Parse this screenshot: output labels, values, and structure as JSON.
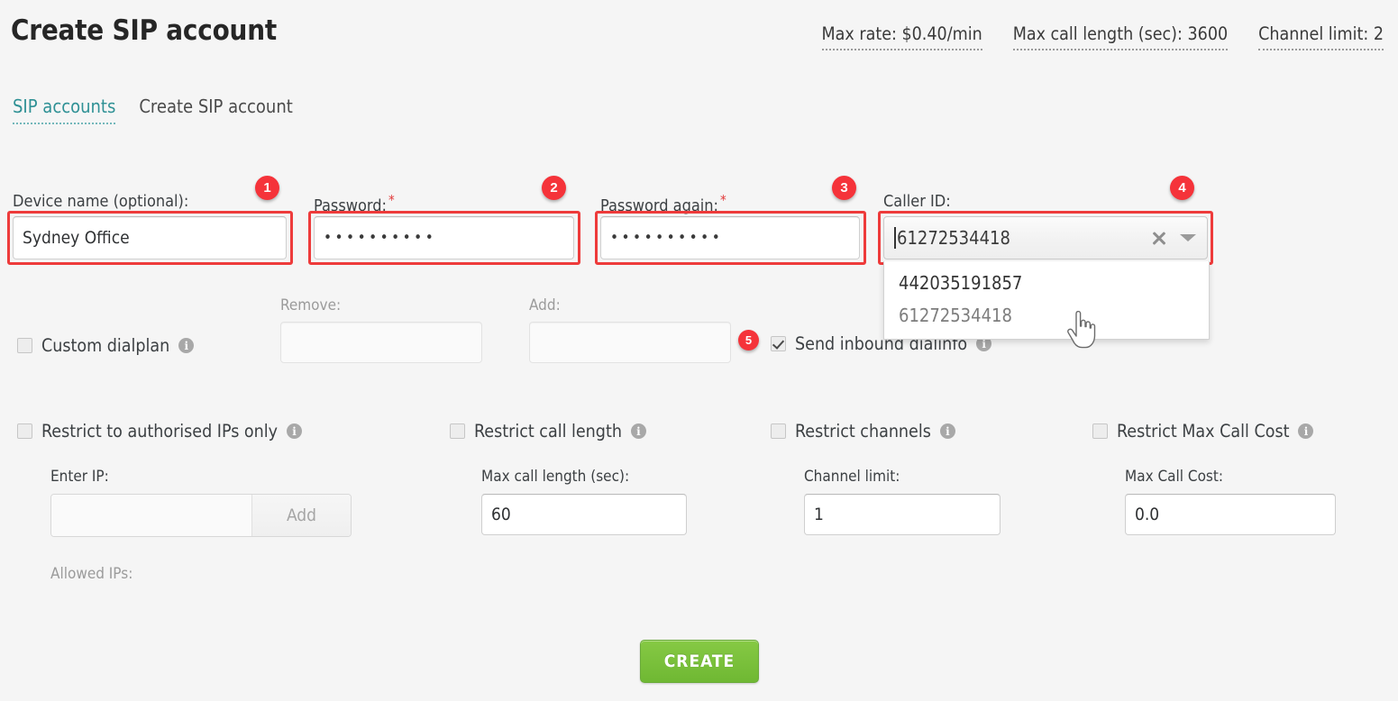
{
  "header": {
    "title": "Create SIP account",
    "stats": [
      {
        "label": "Max rate: $0.40/min"
      },
      {
        "label": "Max call length (sec): 3600"
      },
      {
        "label": "Channel limit: 2"
      }
    ]
  },
  "tabs": [
    {
      "label": "SIP accounts",
      "active": false
    },
    {
      "label": "Create SIP account",
      "active": true
    }
  ],
  "form": {
    "device_name": {
      "label": "Device name (optional):",
      "value": "Sydney Office",
      "placeholder": "",
      "badge": "1"
    },
    "password": {
      "label": "Password:",
      "required_mark": "*",
      "value": "••••••••••",
      "badge": "2"
    },
    "password_again": {
      "label": "Password again:",
      "required_mark": "*",
      "value": "••••••••••",
      "badge": "3"
    },
    "caller_id": {
      "label": "Caller ID:",
      "value": "61272534418",
      "badge": "4",
      "clear_icon": "close-icon",
      "dropdown_icon": "chevron-down-icon",
      "options": [
        {
          "label": "442035191857",
          "hovered": false
        },
        {
          "label": "61272534418",
          "hovered": true
        }
      ]
    },
    "custom_dialplan": {
      "label": "Custom dialplan",
      "checked": false,
      "info_icon": "info-icon"
    },
    "remove": {
      "label": "Remove:",
      "value": "",
      "placeholder": ""
    },
    "add": {
      "label": "Add:",
      "value": "",
      "placeholder": ""
    },
    "send_inbound": {
      "label": "Send inbound dialinfo",
      "checked": true,
      "badge": "5",
      "info_icon": "info-icon"
    },
    "restrictions": [
      {
        "name": "restrict-ips",
        "label": "Restrict to authorised IPs only",
        "checked": false,
        "info_icon": "info-icon"
      },
      {
        "name": "restrict-call-length",
        "label": "Restrict call length",
        "checked": false,
        "info_icon": "info-icon"
      },
      {
        "name": "restrict-channels",
        "label": "Restrict channels",
        "checked": false,
        "info_icon": "info-icon"
      },
      {
        "name": "restrict-max-call-cost",
        "label": "Restrict Max Call Cost",
        "checked": false,
        "info_icon": "info-icon"
      }
    ],
    "enter_ip": {
      "label": "Enter IP:",
      "value": "",
      "placeholder": "",
      "add_button": "Add"
    },
    "allowed_ips": {
      "label": "Allowed IPs:"
    },
    "max_call_length": {
      "label": "Max call length (sec):",
      "value": "60"
    },
    "channel_limit": {
      "label": "Channel limit:",
      "value": "1"
    },
    "max_call_cost": {
      "label": "Max Call Cost:",
      "value": "0.0"
    }
  },
  "actions": {
    "create": "CREATE"
  },
  "cursor": {
    "type": "pointer-hand-cursor"
  },
  "colors": {
    "accent_teal": "#2f9195",
    "annotation_red": "#f5333a",
    "create_green": "#79c03d",
    "background": "#f5f5f5"
  }
}
